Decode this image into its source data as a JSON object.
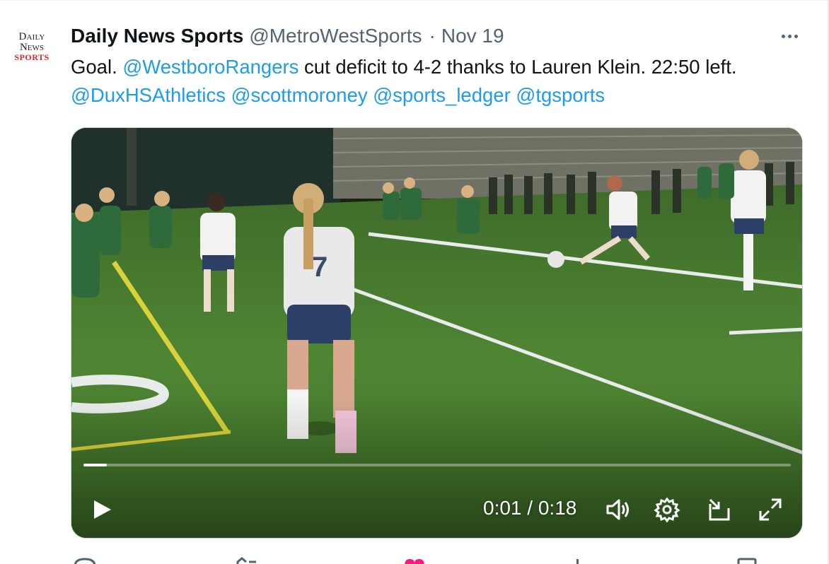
{
  "account": {
    "avatar_text": [
      "Daily",
      "News",
      "SPORTS"
    ],
    "display_name": "Daily News Sports",
    "handle": "@MetroWestSports",
    "separator": "·",
    "date": "Nov 19"
  },
  "tweet": {
    "segments": [
      {
        "type": "text",
        "value": "Goal. "
      },
      {
        "type": "mention",
        "value": "@WestboroRangers"
      },
      {
        "type": "text",
        "value": " cut deficit to 4-2 thanks to Lauren Klein. 22:50 left. "
      },
      {
        "type": "mention",
        "value": "@DuxHSAthletics"
      },
      {
        "type": "text",
        "value": " "
      },
      {
        "type": "mention",
        "value": "@scottmoroney"
      },
      {
        "type": "text",
        "value": " "
      },
      {
        "type": "mention",
        "value": "@sports_ledger"
      },
      {
        "type": "text",
        "value": " "
      },
      {
        "type": "mention",
        "value": "@tgsports"
      }
    ]
  },
  "video": {
    "current_time": "0:01",
    "duration": "0:18",
    "time_display": "0:01 / 0:18",
    "progress": 0.033,
    "controls": [
      "play-icon",
      "volume-icon",
      "settings-gear-icon",
      "pop-out-icon",
      "fullscreen-icon"
    ]
  },
  "actions": [
    "reply-icon",
    "retweet-icon",
    "like-icon",
    "views-icon",
    "bookmark-icon"
  ],
  "colors": {
    "accent": "#1d9bf0",
    "text": "#0f1419",
    "secondary": "#536471",
    "brand_red": "#d02a2a",
    "like_pink": "#f91880"
  }
}
